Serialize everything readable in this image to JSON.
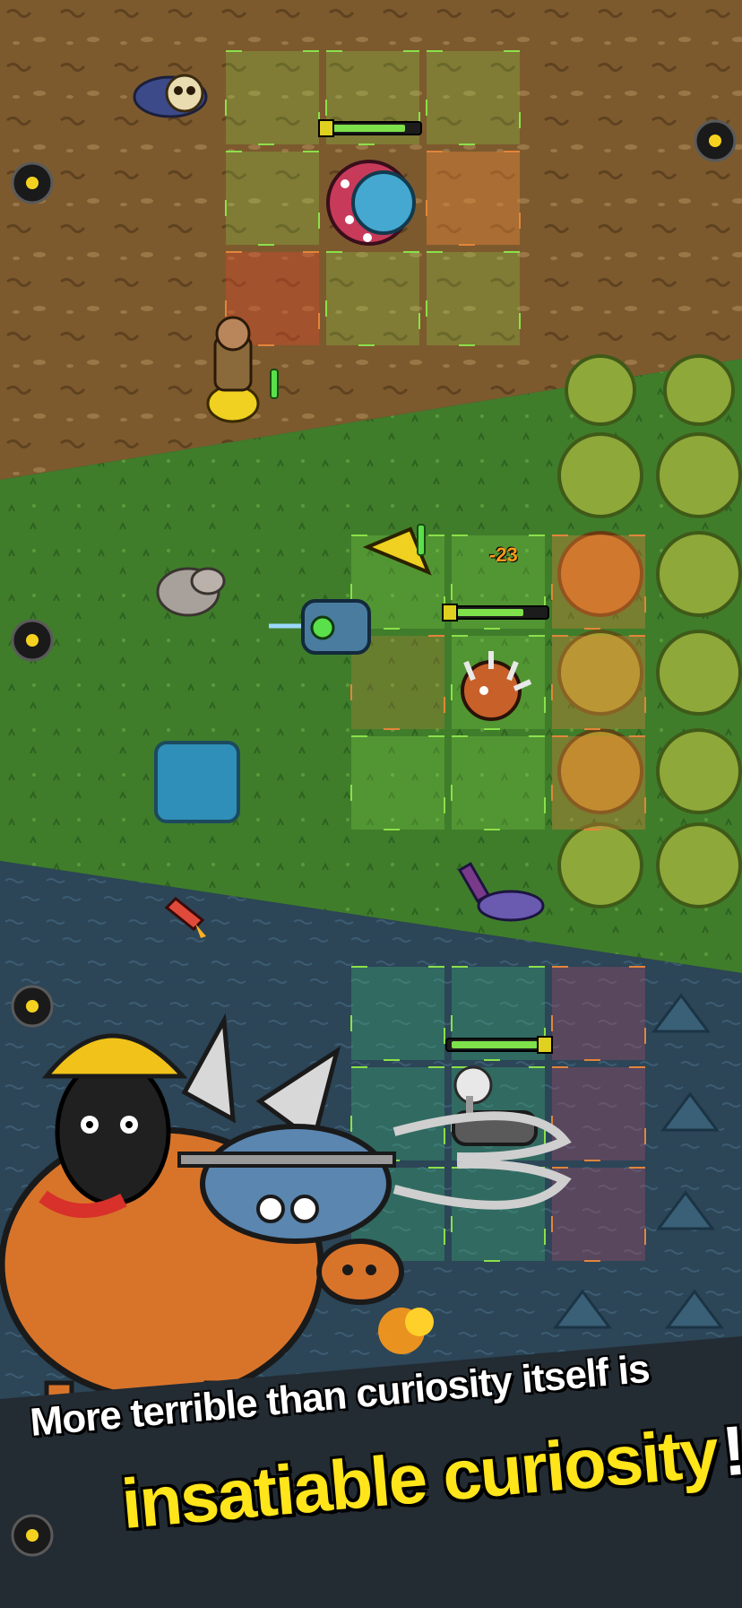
{
  "caption": {
    "line1": "More terrible than curiosity itself is",
    "line2_main": "insatiable curiosity",
    "line2_bang": "!"
  },
  "hud": {
    "damage_popup": "-23"
  },
  "zones": [
    "dirt",
    "grass",
    "water"
  ],
  "colors": {
    "dirt": "#7d5a2e",
    "grass": "#3d7a2a",
    "water": "#2c4557",
    "caption_yellow": "#ffe51a",
    "grid_green": "#8be04a",
    "grid_orange": "#e2853a",
    "health_bar": "#7ee04a",
    "waypoint": "#f5d21f"
  },
  "icons": [
    "skull-pile-icon",
    "spiked-mine-icon",
    "scarecrow-icon",
    "drill-mech-icon",
    "spiked-ball-enemy-icon",
    "rocket-icon",
    "radar-tank-icon",
    "pig-mech-icon",
    "waypoint-marker-icon"
  ]
}
